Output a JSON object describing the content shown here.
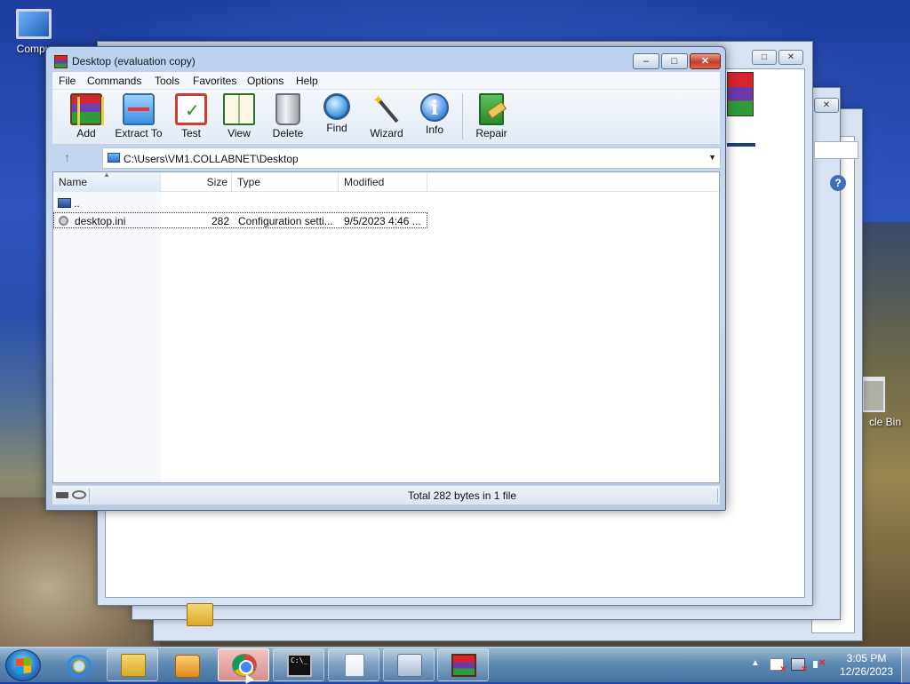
{
  "desktop": {
    "icons": [
      {
        "label": "Compu"
      },
      {
        "label": "cle Bin"
      }
    ]
  },
  "window": {
    "title": "Desktop (evaluation copy)",
    "caption": {
      "minimize": "–",
      "maximize": "□",
      "close": "✕"
    }
  },
  "menu": [
    "File",
    "Commands",
    "Tools",
    "Favorites",
    "Options",
    "Help"
  ],
  "toolbar": [
    {
      "label": "Add",
      "icon": "add-archive-icon"
    },
    {
      "label": "Extract To",
      "icon": "extract-icon"
    },
    {
      "label": "Test",
      "icon": "test-icon"
    },
    {
      "label": "View",
      "icon": "view-book-icon"
    },
    {
      "label": "Delete",
      "icon": "trash-icon"
    },
    {
      "label": "Find",
      "icon": "magnifier-icon"
    },
    {
      "label": "Wizard",
      "icon": "magic-wand-icon"
    },
    {
      "label": "Info",
      "icon": "info-icon"
    },
    {
      "label": "Repair",
      "icon": "repair-icon"
    }
  ],
  "address": {
    "path": "C:\\Users\\VM1.COLLABNET\\Desktop",
    "up_glyph": "↑",
    "dropdown_glyph": "▼"
  },
  "list": {
    "columns": {
      "name": "Name",
      "size": "Size",
      "type": "Type",
      "modified": "Modified"
    },
    "rows": [
      {
        "name": "..",
        "size": "",
        "type": "",
        "modified": ""
      },
      {
        "name": "desktop.ini",
        "size": "282",
        "type": "Configuration setti...",
        "modified": "9/5/2023 4:46 ..."
      }
    ]
  },
  "status": {
    "text": "Total 282 bytes in 1 file"
  },
  "taskbar": {
    "clock_time": "3:05 PM",
    "clock_date": "12/26/2023",
    "cmd_glyph": "C:\\_"
  }
}
